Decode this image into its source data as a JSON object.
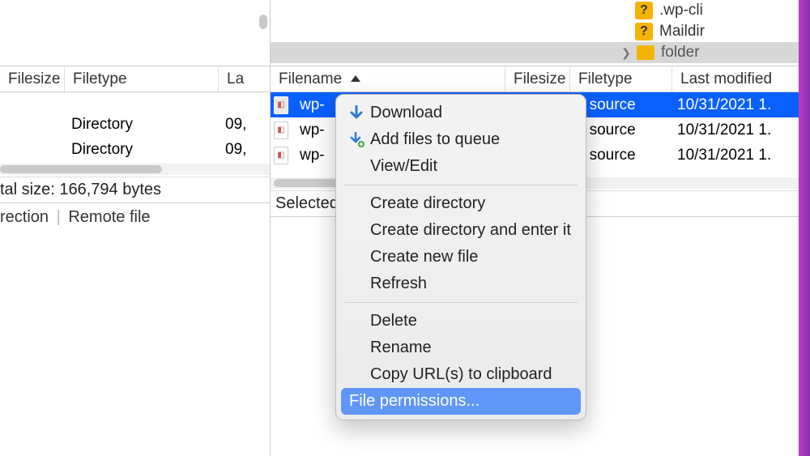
{
  "tree": {
    "items": [
      {
        "name": ".wp-cli",
        "icon": "question"
      },
      {
        "name": "Maildir",
        "icon": "question"
      },
      {
        "name": "folder",
        "icon": "folder",
        "selected": true,
        "expandable": true
      }
    ]
  },
  "leftHeaders": {
    "filesize": "Filesize",
    "filetype": "Filetype",
    "lastmod": "La"
  },
  "rightHeaders": {
    "filename": "Filename",
    "filesize": "Filesize",
    "filetype": "Filetype",
    "lastmod": "Last modified"
  },
  "leftRows": [
    {
      "name": "",
      "filesize": "",
      "filetype": "Directory",
      "lastmod": "09,"
    },
    {
      "name": "",
      "filesize": "",
      "filetype": "Directory",
      "lastmod": "09,"
    }
  ],
  "rightRows": [
    {
      "name": "wp-",
      "filesize": "",
      "filetype": "P source",
      "lastmod": "10/31/2021 1.",
      "selected": true
    },
    {
      "name": "wp-",
      "filesize": "",
      "filetype": "P source",
      "lastmod": "10/31/2021 1."
    },
    {
      "name": "wp-",
      "filesize": "",
      "filetype": "P source",
      "lastmod": "10/31/2021 1."
    }
  ],
  "leftStatus": "tal size: 166,794 bytes",
  "rightStatus": "Selected",
  "bottom": {
    "direction": "rection",
    "remotefile": "Remote file"
  },
  "menu": {
    "download": "Download",
    "addqueue": "Add files to queue",
    "viewedit": "View/Edit",
    "createdir": "Create directory",
    "createdirenter": "Create directory and enter it",
    "createfile": "Create new file",
    "refresh": "Refresh",
    "delete": "Delete",
    "rename": "Rename",
    "copyurl": "Copy URL(s) to clipboard",
    "permissions": "File permissions..."
  }
}
